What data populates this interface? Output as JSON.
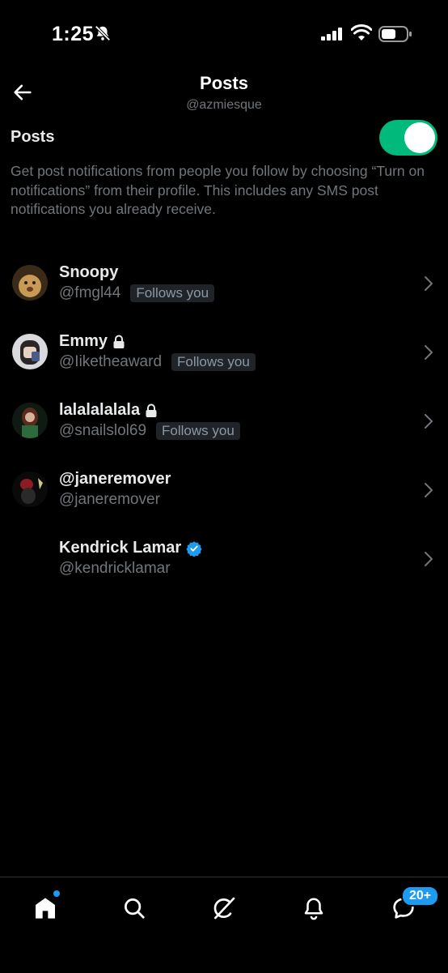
{
  "status_bar": {
    "time": "1:25"
  },
  "header": {
    "title": "Posts",
    "subtitle": "@azmiesque"
  },
  "setting": {
    "label": "Posts",
    "enabled": true,
    "description": "Get post notifications from people you follow by choosing “Turn on notifications” from their profile. This includes any SMS post notifications you already receive."
  },
  "users": [
    {
      "name": "Snoopy",
      "handle": "@fmgl44",
      "badge": "Follows you",
      "locked": false,
      "verified": false
    },
    {
      "name": "Emmy",
      "handle": "@Iiketheaward",
      "badge": "Follows you",
      "locked": true,
      "verified": false
    },
    {
      "name": "lalalalalala",
      "handle": "@snailslol69",
      "badge": "Follows you",
      "locked": true,
      "verified": false
    },
    {
      "name": "@janeremover",
      "handle": "@janeremover",
      "badge": "",
      "locked": false,
      "verified": false
    },
    {
      "name": "Kendrick Lamar",
      "handle": "@kendricklamar",
      "badge": "",
      "locked": false,
      "verified": true
    }
  ],
  "tab_bar": {
    "tabs": [
      "home-icon",
      "search-icon",
      "grok-icon",
      "notifications-icon",
      "messages-icon"
    ],
    "messages_badge": "20+"
  },
  "colors": {
    "accent": "#1d9bf0",
    "toggle_on": "#00ba7c",
    "muted": "#71767b"
  }
}
